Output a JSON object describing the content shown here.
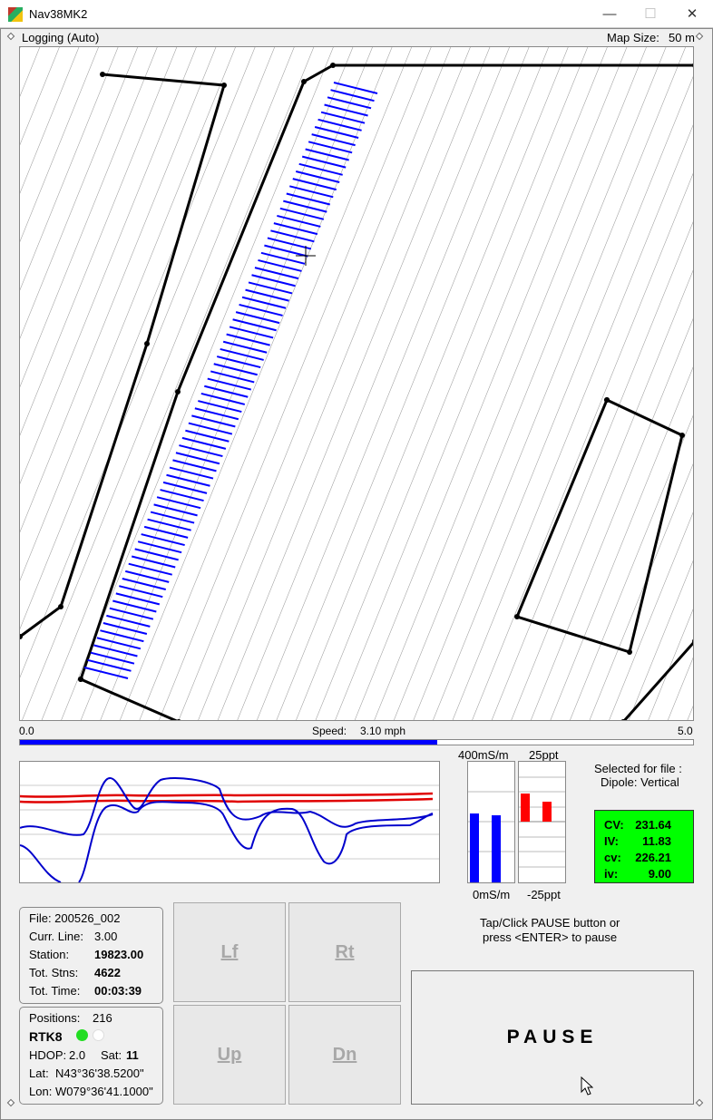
{
  "window": {
    "title": "Nav38MK2",
    "minimize": "—",
    "maximize": "☐",
    "close": "✕"
  },
  "header": {
    "status": "Logging (Auto)",
    "map_size_label": "Map Size:",
    "map_size_value": "50 m"
  },
  "speed": {
    "min_label": "0.0",
    "max_label": "5.0",
    "label": "Speed:",
    "value": "3.10 mph",
    "fraction": 0.62
  },
  "gauges": {
    "cond_top": "400mS/m",
    "cond_bottom": "0mS/m",
    "inph_top": "25ppt",
    "inph_bottom": "-25ppt"
  },
  "selection": {
    "line1": "Selected for file :",
    "line2": "Dipole: Vertical"
  },
  "readout": {
    "cv_label": "CV:",
    "cv_value": "231.64",
    "iv_label": "IV:",
    "iv_value": "11.83",
    "cv2_label": "cv:",
    "cv2_value": "226.21",
    "iv2_label": "iv:",
    "iv2_value": "9.00",
    "bg_color": "#00ff00"
  },
  "file_panel": {
    "file": "File: 200526_002",
    "curr_line_label": "Curr. Line:",
    "curr_line_value": "3.00",
    "station_label": "Station:",
    "station_value": "19823.00",
    "tot_stns_label": "Tot. Stns:",
    "tot_stns_value": "4622",
    "tot_time_label": "Tot. Time:",
    "tot_time_value": "00:03:39"
  },
  "gps_panel": {
    "positions_label": "Positions:",
    "positions_value": "216",
    "fix": "RTK8",
    "hdop_label": "HDOP:",
    "hdop_value": "2.0",
    "sat_label": "Sat:",
    "sat_value": "11",
    "lat_label": "Lat:",
    "lat_value": "N43°36'38.5200\"",
    "lon_label": "Lon:",
    "lon_value": "W079°36'41.1000\""
  },
  "nav_buttons": {
    "left": "Lf",
    "right": "Rt",
    "up": "Up",
    "down": "Dn"
  },
  "pause": {
    "hint_line1": "Tap/Click PAUSE button or",
    "hint_line2": "press <ENTER> to pause",
    "label": "PAUSE"
  },
  "colors": {
    "track": "#0000ff",
    "boundary": "#000000",
    "trend_red": "#e00000",
    "trend_blue": "#0000cc",
    "gps_ok": "#22dd22"
  }
}
